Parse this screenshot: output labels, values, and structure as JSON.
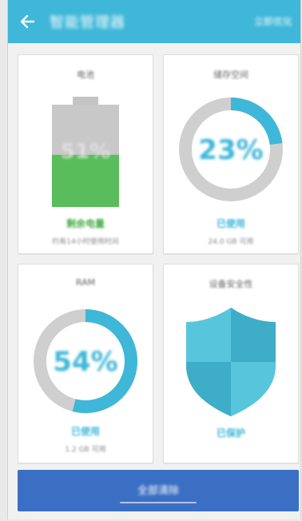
{
  "app_bar": {
    "title": "智能管理器",
    "action": "立即优化",
    "back_icon": "arrow-left-icon",
    "color": "#3fb7d8"
  },
  "cards": {
    "battery": {
      "title": "电池",
      "percent": "51%",
      "level": 0.51,
      "status": "剩余电量",
      "sub": "约有14小时使用时间",
      "status_color": "#4caf50"
    },
    "storage": {
      "title": "储存空间",
      "percent": "23%",
      "used_fraction": 0.23,
      "status": "已使用",
      "sub": "24.0 GB 可用"
    },
    "ram": {
      "title": "RAM",
      "percent": "54%",
      "used_fraction": 0.54,
      "status": "已使用",
      "sub": "1.2 GB 可用"
    },
    "security": {
      "title": "设备安全性",
      "status": "已保护",
      "icon": "shield-icon"
    }
  },
  "bottom_button": {
    "label": "全部清除",
    "color": "#3b6fc4"
  },
  "accent_color": "#3fb7d8"
}
